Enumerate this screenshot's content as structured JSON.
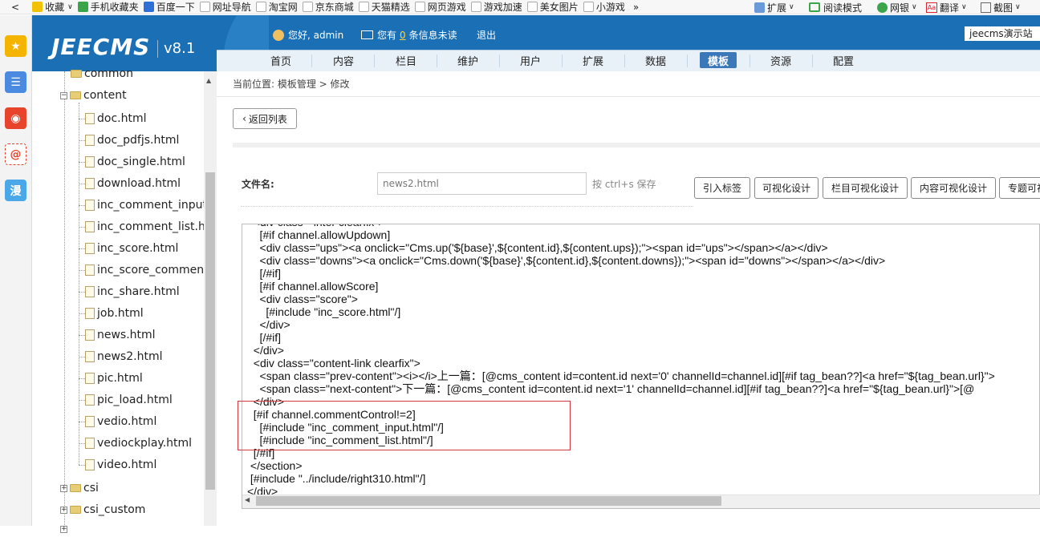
{
  "bookmark_bar": {
    "back": "<",
    "items": [
      "收藏",
      "手机收藏夹",
      "百度一下",
      "网址导航",
      "淘宝网",
      "京东商城",
      "天猫精选",
      "网页游戏",
      "游戏加速",
      "美女图片",
      "小游戏"
    ],
    "more": "»",
    "right_items": [
      "扩展",
      "阅读模式",
      "网银",
      "翻译",
      "截图"
    ]
  },
  "side_icons": [
    "favorites-icon",
    "list-icon",
    "weibo-icon",
    "mail-icon",
    "comic-icon"
  ],
  "side_icon_glyphs": [
    "★",
    "☰",
    "◉",
    "@",
    "漫"
  ],
  "header": {
    "logo": "JEECMS",
    "version": "v8.1",
    "greeting": "您好, admin",
    "msg_prefix": "您有",
    "msg_count": "0",
    "msg_suffix": "条信息未读",
    "logout": "退出",
    "site": "jeecms演示站"
  },
  "nav": [
    "首页",
    "内容",
    "栏目",
    "维护",
    "用户",
    "扩展",
    "数据",
    "模板",
    "资源",
    "配置"
  ],
  "nav_active": "模板",
  "tree": {
    "partial_top": "common",
    "content_folder": "content",
    "files": [
      "doc.html",
      "doc_pdfjs.html",
      "doc_single.html",
      "download.html",
      "inc_comment_input",
      "inc_comment_list.ht",
      "inc_score.html",
      "inc_score_comment",
      "inc_share.html",
      "job.html",
      "news.html",
      "news2.html",
      "pic.html",
      "pic_load.html",
      "vedio.html",
      "vediockplay.html",
      "video.html"
    ],
    "folders": [
      "csi",
      "csi_custom"
    ]
  },
  "breadcrumb": "当前位置: 模板管理 > 修改",
  "back_button": "返回列表",
  "filename_label": "文件名:",
  "filename_value": "news2.html",
  "save_hint": "按 ctrl+s 保存",
  "toolbar": [
    "引入标签",
    "可视化设计",
    "栏目可视化设计",
    "内容可视化设计",
    "专题可视"
  ],
  "code_lines": [
    "  <div class=\"inter clearfix\">",
    "    [#if channel.allowUpdown]",
    "    <div class=\"ups\"><a onclick=\"Cms.up('${base}',${content.id},${content.ups});\"><span id=\"ups\"></span></a></div>",
    "    <div class=\"downs\"><a onclick=\"Cms.down('${base}',${content.id},${content.downs});\"><span id=\"downs\"></span></a></div>",
    "    [/#if]",
    "    [#if channel.allowScore]",
    "    <div class=\"score\">",
    "      [#include \"inc_score.html\"/]",
    "    </div>",
    "    [/#if]",
    "  </div>",
    "  <div class=\"content-link clearfix\">",
    "    <span class=\"prev-content\"><i></i>上一篇：[@cms_content id=content.id next='0' channelId=channel.id][#if tag_bean??]<a href=\"${tag_bean.url}\">",
    "    <span class=\"next-content\">下一篇：[@cms_content id=content.id next='1' channelId=channel.id][#if tag_bean??]<a href=\"${tag_bean.url}\">[@",
    "  </div>",
    "  [#if channel.commentControl!=2]",
    "    [#include \"inc_comment_input.html\"/]",
    "    [#include \"inc_comment_list.html\"/]",
    "  [/#if]",
    " </section>",
    " [#include \"../include/right310.html\"/]",
    "</div>"
  ]
}
